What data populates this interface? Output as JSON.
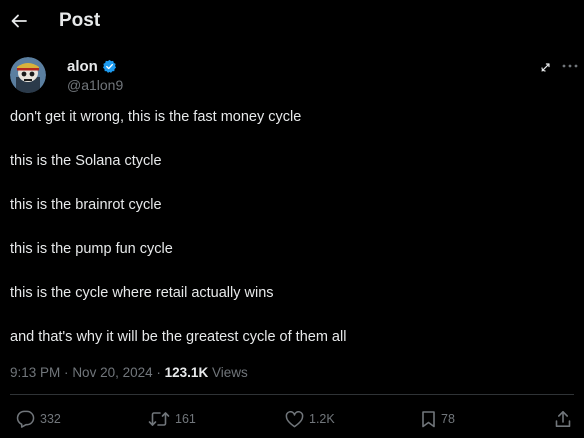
{
  "header": {
    "title": "Post"
  },
  "author": {
    "display_name": "alon",
    "handle": "@a1lon9",
    "verified": true
  },
  "post": {
    "lines": [
      "don't get it wrong, this is the fast money cycle",
      "this is the Solana ctycle",
      "this is the brainrot cycle",
      "this is the pump fun cycle",
      "this is the cycle where retail actually wins",
      "and that's why it will be the greatest cycle of them all"
    ]
  },
  "meta": {
    "time": "9:13 PM",
    "separator": "·",
    "date": "Nov 20, 2024",
    "views_count": "123.1K",
    "views_label": "Views"
  },
  "actions": {
    "replies": "332",
    "reposts": "161",
    "likes": "1.2K",
    "bookmarks": "78"
  },
  "colors": {
    "background": "#000000",
    "text_primary": "#e7e9ea",
    "text_secondary": "#71767b",
    "verified_blue": "#1d9bf0",
    "divider": "#2f3336"
  },
  "icons": {
    "back": "arrow-left-icon",
    "verified": "verified-badge-icon",
    "grok": "grok-icon",
    "more": "more-horizontal-icon",
    "reply": "reply-bubble-icon",
    "repost": "repost-icon",
    "like": "heart-icon",
    "bookmark": "bookmark-icon",
    "share": "share-icon"
  }
}
